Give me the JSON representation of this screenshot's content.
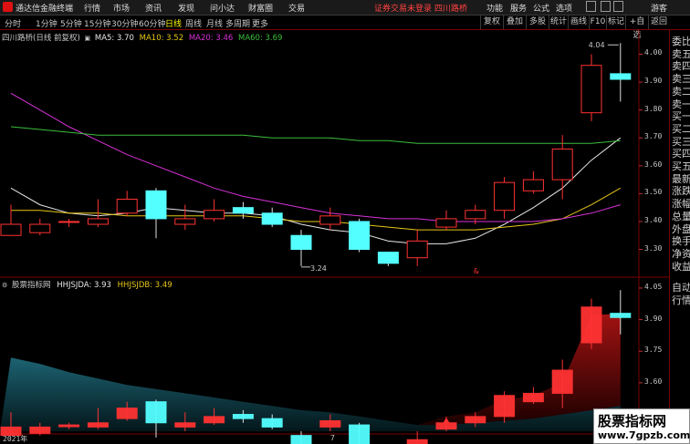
{
  "menu": {
    "logo_text": "通达信金融终端",
    "items": [
      "行情",
      "市场",
      "资讯",
      "发现",
      "问小达",
      "财富圈",
      "交易"
    ],
    "login_notice": "证券交易未登录",
    "stock_name": "四川路桥",
    "right_items": [
      "功能",
      "服务",
      "公式",
      "选项"
    ],
    "guest": "游客"
  },
  "periods": [
    "分时",
    "1分钟",
    "5分钟",
    "15分钟",
    "30分钟",
    "60分钟",
    "日线",
    "周线",
    "月线",
    "多周期",
    "更多"
  ],
  "active_period": "日线",
  "tools": [
    "复权",
    "叠加",
    "多股",
    "统计",
    "画线",
    "F10",
    "标记",
    "+自选",
    "返回"
  ],
  "main_legend": {
    "title": "四川路桥(日线 前复权)",
    "ma5": "MA5: 3.70",
    "ma10": "MA10: 3.52",
    "ma20": "MA20: 3.46",
    "ma60": "MA60: 3.69",
    "colors": {
      "ma5": "#e6e6e6",
      "ma10": "#e6c619",
      "ma20": "#d732d7",
      "ma60": "#3cbe3c"
    }
  },
  "sub_legend": {
    "title": "股票指标网",
    "a": "HHJSJDA: 3.93",
    "b": "HHJSJDB: 3.49"
  },
  "price_axis": [
    "4.00",
    "3.90",
    "3.80",
    "3.70",
    "3.60",
    "3.50",
    "3.40",
    "3.30"
  ],
  "sub_axis": [
    "4.05",
    "3.90",
    "3.75",
    "3.60",
    "3.45"
  ],
  "annotations": {
    "high": "4.04",
    "low": "3.24",
    "marker": "&"
  },
  "xaxis": {
    "year": "2021年",
    "month": "7"
  },
  "sidepanel": {
    "items": [
      "委比",
      "卖五",
      "卖四",
      "卖三",
      "卖二",
      "卖一",
      "买一",
      "买二",
      "买三",
      "买四",
      "买五",
      "最新",
      "涨跌",
      "涨幅",
      "总量",
      "外盘",
      "换手",
      "净资",
      "收益"
    ],
    "lower": [
      "自动",
      "行情"
    ]
  },
  "watermark": {
    "line1": "股票指标网",
    "line2": "www.7gpzb.com"
  },
  "chart_data": {
    "type": "candlestick",
    "candles": [
      {
        "o": 3.35,
        "c": 3.39,
        "h": 3.46,
        "l": 3.35
      },
      {
        "o": 3.36,
        "c": 3.39,
        "h": 3.41,
        "l": 3.35
      },
      {
        "o": 3.4,
        "c": 3.4,
        "h": 3.41,
        "l": 3.38
      },
      {
        "o": 3.39,
        "c": 3.41,
        "h": 3.48,
        "l": 3.38
      },
      {
        "o": 3.43,
        "c": 3.48,
        "h": 3.51,
        "l": 3.42
      },
      {
        "o": 3.51,
        "c": 3.41,
        "h": 3.52,
        "l": 3.34
      },
      {
        "o": 3.39,
        "c": 3.41,
        "h": 3.46,
        "l": 3.37
      },
      {
        "o": 3.41,
        "c": 3.44,
        "h": 3.48,
        "l": 3.4
      },
      {
        "o": 3.45,
        "c": 3.43,
        "h": 3.47,
        "l": 3.41
      },
      {
        "o": 3.43,
        "c": 3.39,
        "h": 3.45,
        "l": 3.38
      },
      {
        "o": 3.35,
        "c": 3.3,
        "h": 3.37,
        "l": 3.24
      },
      {
        "o": 3.39,
        "c": 3.42,
        "h": 3.45,
        "l": 3.37
      },
      {
        "o": 3.4,
        "c": 3.3,
        "h": 3.41,
        "l": 3.29
      },
      {
        "o": 3.29,
        "c": 3.25,
        "h": 3.29,
        "l": 3.24
      },
      {
        "o": 3.27,
        "c": 3.33,
        "h": 3.37,
        "l": 3.24
      },
      {
        "o": 3.38,
        "c": 3.41,
        "h": 3.44,
        "l": 3.37
      },
      {
        "o": 3.41,
        "c": 3.44,
        "h": 3.46,
        "l": 3.39
      },
      {
        "o": 3.44,
        "c": 3.54,
        "h": 3.56,
        "l": 3.41
      },
      {
        "o": 3.51,
        "c": 3.55,
        "h": 3.58,
        "l": 3.5
      },
      {
        "o": 3.55,
        "c": 3.66,
        "h": 3.71,
        "l": 3.48
      },
      {
        "o": 3.79,
        "c": 3.96,
        "h": 4.0,
        "l": 3.76
      },
      {
        "o": 3.93,
        "c": 3.91,
        "h": 4.04,
        "l": 3.83
      }
    ],
    "ma": {
      "MA5": [
        3.52,
        3.46,
        3.43,
        3.42,
        3.43,
        3.45,
        3.44,
        3.43,
        3.43,
        3.42,
        3.39,
        3.37,
        3.36,
        3.33,
        3.32,
        3.32,
        3.34,
        3.39,
        3.45,
        3.52,
        3.62,
        3.7
      ],
      "MA10": [
        3.44,
        3.44,
        3.43,
        3.43,
        3.42,
        3.42,
        3.42,
        3.42,
        3.42,
        3.41,
        3.4,
        3.4,
        3.39,
        3.38,
        3.37,
        3.37,
        3.37,
        3.38,
        3.39,
        3.41,
        3.46,
        3.52
      ],
      "MA20": [
        3.86,
        3.8,
        3.74,
        3.69,
        3.64,
        3.6,
        3.56,
        3.52,
        3.49,
        3.47,
        3.45,
        3.43,
        3.42,
        3.41,
        3.41,
        3.4,
        3.4,
        3.4,
        3.4,
        3.41,
        3.43,
        3.46
      ],
      "MA60": [
        3.74,
        3.73,
        3.72,
        3.71,
        3.71,
        3.71,
        3.71,
        3.71,
        3.71,
        3.7,
        3.7,
        3.7,
        3.69,
        3.69,
        3.68,
        3.68,
        3.68,
        3.68,
        3.68,
        3.68,
        3.68,
        3.69
      ]
    },
    "price_range": [
      3.22,
      4.08
    ],
    "indicator": {
      "range": [
        3.37,
        4.08
      ],
      "HHJSJDA": [
        3.45,
        3.45,
        3.46,
        3.48,
        3.49,
        3.49,
        3.46,
        3.45,
        3.45,
        3.43,
        3.38,
        3.42,
        3.38,
        3.37,
        3.36,
        3.44,
        3.46,
        3.52,
        3.54,
        3.6,
        3.92,
        3.93
      ],
      "HHJSJDB": [
        3.72,
        3.69,
        3.65,
        3.62,
        3.59,
        3.57,
        3.55,
        3.53,
        3.51,
        3.49,
        3.47,
        3.46,
        3.44,
        3.42,
        3.4,
        3.4,
        3.41,
        3.42,
        3.43,
        3.45,
        3.47,
        3.49
      ]
    },
    "colors": {
      "up": "#ff3232",
      "down": "#54ffff",
      "grid": "#7a0000"
    }
  }
}
